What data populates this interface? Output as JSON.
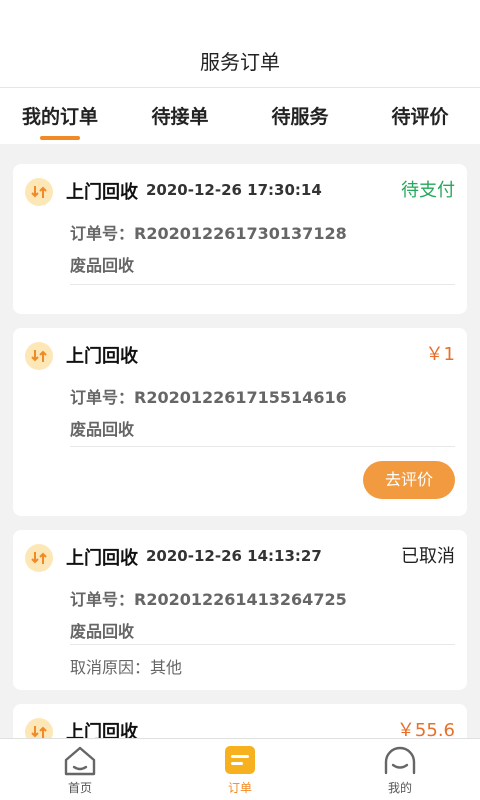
{
  "header": {
    "title": "服务订单"
  },
  "tabs": [
    {
      "label": "我的订单",
      "active": true
    },
    {
      "label": "待接单",
      "active": false
    },
    {
      "label": "待服务",
      "active": false
    },
    {
      "label": "待评价",
      "active": false
    }
  ],
  "colors": {
    "accent": "#f08a26",
    "pending": "#24a85a",
    "price": "#e8702a"
  },
  "orders": [
    {
      "service": "上门回收",
      "time": "2020-12-26 17:30:14",
      "status": "待支付",
      "order_no": "订单号：R202012261730137128",
      "category": "废品回收"
    },
    {
      "service": "上门回收",
      "status": "￥1",
      "order_no": "订单号：R202012261715514616",
      "category": "废品回收",
      "action": "去评价"
    },
    {
      "service": "上门回收",
      "time": "2020-12-26 14:13:27",
      "status": "已取消",
      "order_no": "订单号：R202012261413264725",
      "category": "废品回收",
      "reason": "取消原因：其他"
    },
    {
      "service": "上门回收",
      "status": "￥55.6"
    }
  ],
  "nav": [
    {
      "label": "首页",
      "icon": "home-icon",
      "active": false
    },
    {
      "label": "订单",
      "icon": "order-icon",
      "active": true
    },
    {
      "label": "我的",
      "icon": "profile-icon",
      "active": false
    }
  ]
}
